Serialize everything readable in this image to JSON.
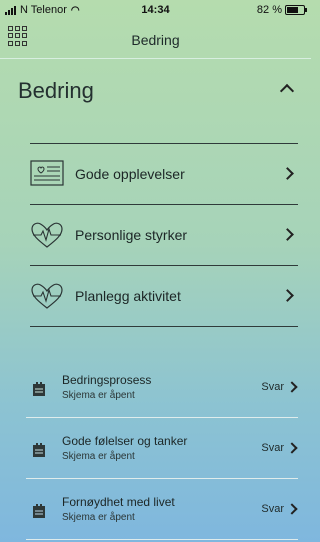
{
  "status": {
    "carrier": "N Telenor",
    "time": "14:34",
    "battery": "82 %",
    "battery_level": 0.82
  },
  "nav": {
    "title": "Bedring"
  },
  "section": {
    "title": "Bedring"
  },
  "menu": [
    {
      "label": "Gode opplevelser",
      "icon": "card-heart-icon"
    },
    {
      "label": "Personlige styrker",
      "icon": "heart-pulse-icon"
    },
    {
      "label": "Planlegg aktivitet",
      "icon": "heart-pulse-icon"
    }
  ],
  "forms": [
    {
      "title": "Bedringsprosess",
      "status": "Skjema er åpent",
      "action": "Svar"
    },
    {
      "title": "Gode følelser og tanker",
      "status": "Skjema er åpent",
      "action": "Svar"
    },
    {
      "title": "Fornøydhet med livet",
      "status": "Skjema er åpent",
      "action": "Svar"
    }
  ]
}
